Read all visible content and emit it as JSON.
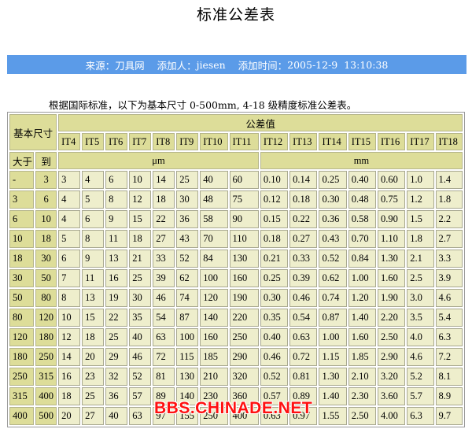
{
  "page": {
    "title": "标准公差表",
    "source_label": "来源：",
    "source": "刀具网",
    "added_by_label": "添加人：",
    "added_by": "jiesen",
    "added_time_label": "添加时间：",
    "added_time": "2005-12-9  13:10:38",
    "intro": "根据国际标准，以下为基本尺寸 0-500mm, 4-18 级精度标准公差表。"
  },
  "table": {
    "size_header": "基本尺寸",
    "tolerance_header": "公差值",
    "from_header": "大于",
    "to_header": "到",
    "unit_um": "μm",
    "unit_mm": "mm",
    "grades": [
      "IT4",
      "IT5",
      "IT6",
      "IT7",
      "IT8",
      "IT9",
      "IT10",
      "IT11",
      "IT12",
      "IT13",
      "IT14",
      "IT15",
      "IT16",
      "IT17",
      "IT18"
    ],
    "rows": [
      {
        "from": "-",
        "to": "3",
        "values": [
          "3",
          "4",
          "6",
          "10",
          "14",
          "25",
          "40",
          "60",
          "0.10",
          "0.14",
          "0.25",
          "0.40",
          "0.60",
          "1.0",
          "1.4"
        ]
      },
      {
        "from": "3",
        "to": "6",
        "values": [
          "4",
          "5",
          "8",
          "12",
          "18",
          "30",
          "48",
          "75",
          "0.12",
          "0.18",
          "0.30",
          "0.48",
          "0.75",
          "1.2",
          "1.8"
        ]
      },
      {
        "from": "6",
        "to": "10",
        "values": [
          "4",
          "6",
          "9",
          "15",
          "22",
          "36",
          "58",
          "90",
          "0.15",
          "0.22",
          "0.36",
          "0.58",
          "0.90",
          "1.5",
          "2.2"
        ]
      },
      {
        "from": "10",
        "to": "18",
        "values": [
          "5",
          "8",
          "11",
          "18",
          "27",
          "43",
          "70",
          "110",
          "0.18",
          "0.27",
          "0.43",
          "0.70",
          "1.10",
          "1.8",
          "2.7"
        ]
      },
      {
        "from": "18",
        "to": "30",
        "values": [
          "6",
          "9",
          "13",
          "21",
          "33",
          "52",
          "84",
          "130",
          "0.21",
          "0.33",
          "0.52",
          "0.84",
          "1.30",
          "2.1",
          "3.3"
        ]
      },
      {
        "from": "30",
        "to": "50",
        "values": [
          "7",
          "11",
          "16",
          "25",
          "39",
          "62",
          "100",
          "160",
          "0.25",
          "0.39",
          "0.62",
          "1.00",
          "1.60",
          "2.5",
          "3.9"
        ]
      },
      {
        "from": "50",
        "to": "80",
        "values": [
          "8",
          "13",
          "19",
          "30",
          "46",
          "74",
          "120",
          "190",
          "0.30",
          "0.46",
          "0.74",
          "1.20",
          "1.90",
          "3.0",
          "4.6"
        ]
      },
      {
        "from": "80",
        "to": "120",
        "values": [
          "10",
          "15",
          "22",
          "35",
          "54",
          "87",
          "140",
          "220",
          "0.35",
          "0.54",
          "0.87",
          "1.40",
          "2.20",
          "3.5",
          "5.4"
        ]
      },
      {
        "from": "120",
        "to": "180",
        "values": [
          "12",
          "18",
          "25",
          "40",
          "63",
          "100",
          "160",
          "250",
          "0.40",
          "0.63",
          "1.00",
          "1.60",
          "2.50",
          "4.0",
          "6.3"
        ]
      },
      {
        "from": "180",
        "to": "250",
        "values": [
          "14",
          "20",
          "29",
          "46",
          "72",
          "115",
          "185",
          "290",
          "0.46",
          "0.72",
          "1.15",
          "1.85",
          "2.90",
          "4.6",
          "7.2"
        ]
      },
      {
        "from": "250",
        "to": "315",
        "values": [
          "16",
          "23",
          "32",
          "52",
          "81",
          "130",
          "210",
          "320",
          "0.52",
          "0.81",
          "1.30",
          "2.10",
          "3.20",
          "5.2",
          "8.1"
        ]
      },
      {
        "from": "315",
        "to": "400",
        "values": [
          "18",
          "25",
          "36",
          "57",
          "89",
          "140",
          "230",
          "360",
          "0.57",
          "0.89",
          "1.40",
          "2.30",
          "3.60",
          "5.7",
          "8.9"
        ]
      },
      {
        "from": "400",
        "to": "500",
        "values": [
          "20",
          "27",
          "40",
          "63",
          "97",
          "155",
          "250",
          "400",
          "0.63",
          "0.97",
          "1.55",
          "2.50",
          "4.00",
          "6.3",
          "9.7"
        ]
      }
    ]
  },
  "watermark": "BBS.CHINADE.NET"
}
